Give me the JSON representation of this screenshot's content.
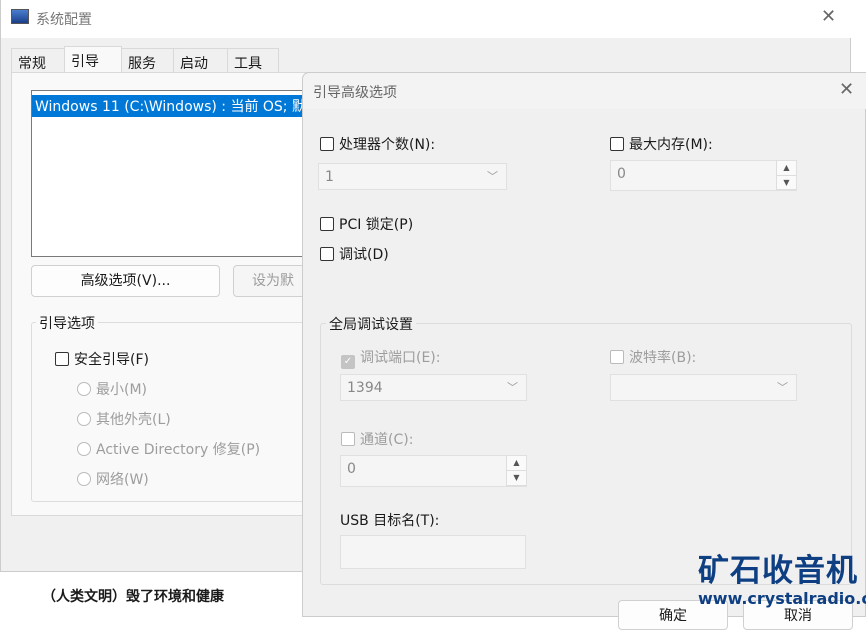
{
  "main": {
    "title": "系统配置",
    "tabs": [
      "常规",
      "引导",
      "服务",
      "启动",
      "工具"
    ],
    "os_entry": "Windows 11 (C:\\Windows) : 当前 OS; 默",
    "advanced_button": "高级选项(V)...",
    "set_default_button": "设为默",
    "boot_options_label": "引导选项",
    "safe_boot": "安全引导(F)",
    "radios": [
      "最小(M)",
      "其他外壳(L)",
      "Active Directory 修复(P)",
      "网络(W)"
    ]
  },
  "background_text": "（人类文明）毁了环境和健康",
  "dialog": {
    "title": "引导高级选项",
    "num_processors": "处理器个数(N):",
    "num_processors_value": "1",
    "max_memory": "最大内存(M):",
    "max_memory_value": "0",
    "pci_lock": "PCI 锁定(P)",
    "debug": "调试(D)",
    "global_debug_label": "全局调试设置",
    "debug_port": "调试端口(E):",
    "debug_port_value": "1394",
    "baud_rate": "波特率(B):",
    "channel": "通道(C):",
    "channel_value": "0",
    "usb_target": "USB 目标名(T):",
    "ok": "确定",
    "cancel": "取消"
  },
  "watermark": {
    "name": "矿石收音机",
    "url": "www.crystalradio.cn"
  }
}
